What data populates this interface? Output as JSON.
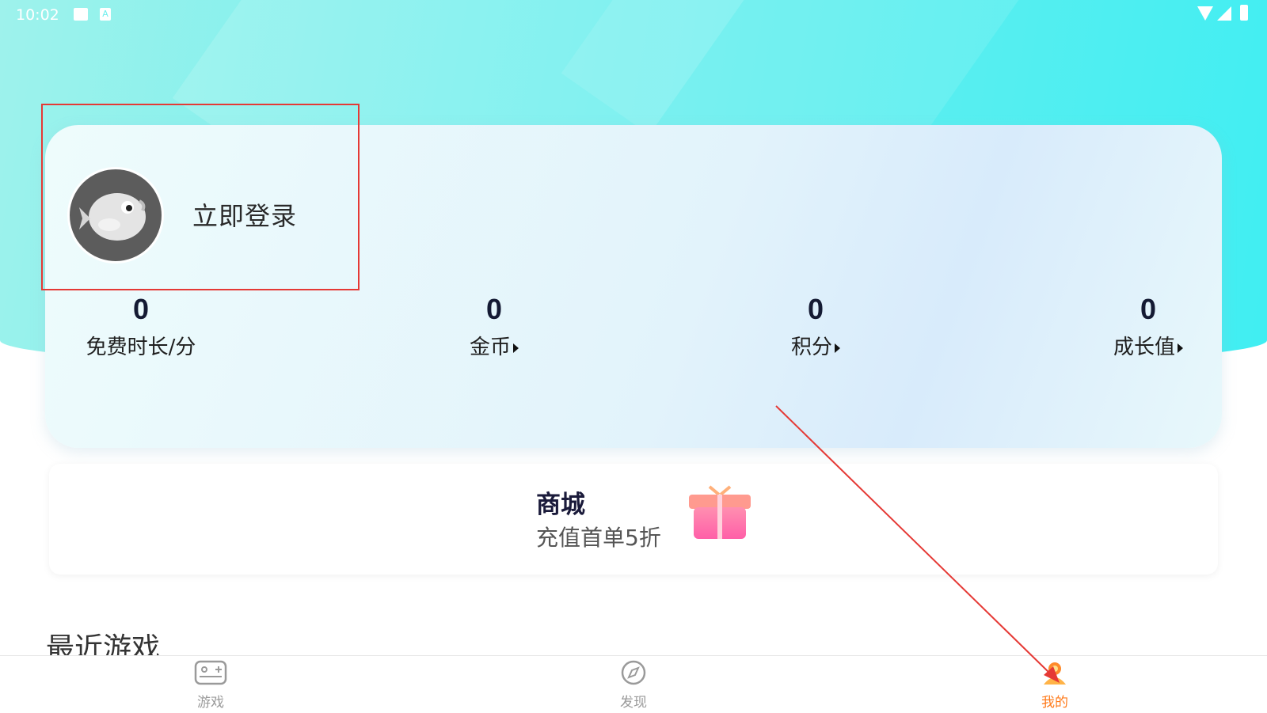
{
  "status_bar": {
    "time": "10:02",
    "icons": [
      "image-icon",
      "a-icon",
      "wifi-icon",
      "signal-icon",
      "battery-icon"
    ]
  },
  "profile": {
    "login_label": "立即登录",
    "avatar_icon": "fish-avatar-icon"
  },
  "stats": [
    {
      "value": "0",
      "label": "免费时长/分",
      "arrow": false
    },
    {
      "value": "0",
      "label": "金币",
      "arrow": true
    },
    {
      "value": "0",
      "label": "积分",
      "arrow": true
    },
    {
      "value": "0",
      "label": "成长值",
      "arrow": true
    }
  ],
  "mall": {
    "title": "商城",
    "subtitle": "充值首单5折",
    "icon": "gift-icon"
  },
  "recent_games": {
    "title": "最近游戏"
  },
  "tabs": [
    {
      "label": "游戏",
      "icon": "gamepad-icon",
      "active": false
    },
    {
      "label": "发现",
      "icon": "compass-icon",
      "active": false
    },
    {
      "label": "我的",
      "icon": "profile-icon",
      "active": true
    }
  ],
  "colors": {
    "accent": "#ff7a1a",
    "header_start": "#9ef2ec",
    "header_end": "#40eef2",
    "annotation": "#e53935"
  }
}
